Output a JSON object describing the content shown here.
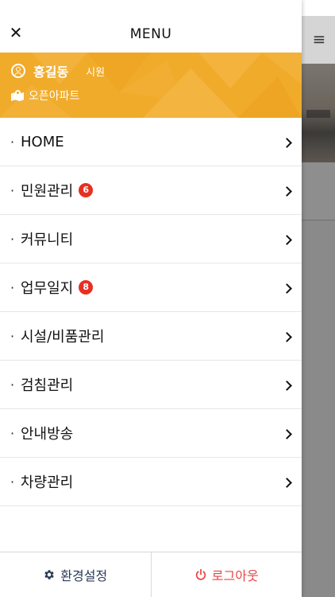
{
  "header": {
    "title": "MENU",
    "close_icon": "close-icon"
  },
  "profile": {
    "name": "홍길동",
    "role": "시원",
    "apartment": "오픈아파트",
    "background_color": "#f1ab2a"
  },
  "menu": {
    "items": [
      {
        "label": "HOME",
        "badge": null
      },
      {
        "label": "민원관리",
        "badge": "6"
      },
      {
        "label": "커뮤니티",
        "badge": null
      },
      {
        "label": "업무일지",
        "badge": "8"
      },
      {
        "label": "시설/비품관리",
        "badge": null
      },
      {
        "label": "검침관리",
        "badge": null
      },
      {
        "label": "안내방송",
        "badge": null
      },
      {
        "label": "차량관리",
        "badge": null
      }
    ],
    "bullet": "·",
    "badge_color": "#e63022"
  },
  "footer": {
    "settings_label": "환경설정",
    "logout_label": "로그아웃",
    "settings_color": "#2a3a55",
    "logout_color": "#e64545"
  },
  "background_app": {
    "menu_icon": "hamburger-icon"
  }
}
